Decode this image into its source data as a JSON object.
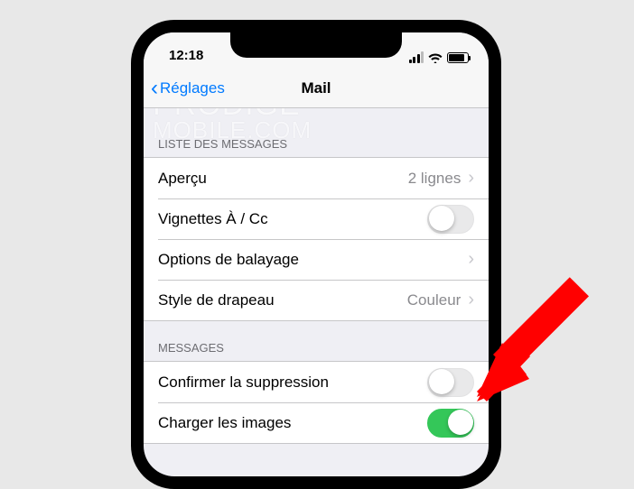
{
  "status": {
    "time": "12:18"
  },
  "nav": {
    "back": "Réglages",
    "title": "Mail"
  },
  "watermark": {
    "line1": "PRODIGE",
    "line2": "MOBILE.COM"
  },
  "section1": {
    "header": "LISTE DES MESSAGES",
    "apercu_label": "Aperçu",
    "apercu_value": "2 lignes",
    "vignettes_label": "Vignettes À / Cc",
    "balayage_label": "Options de balayage",
    "drapeau_label": "Style de drapeau",
    "drapeau_value": "Couleur"
  },
  "section2": {
    "header": "MESSAGES",
    "confirmer_label": "Confirmer la suppression",
    "charger_label": "Charger les images"
  }
}
